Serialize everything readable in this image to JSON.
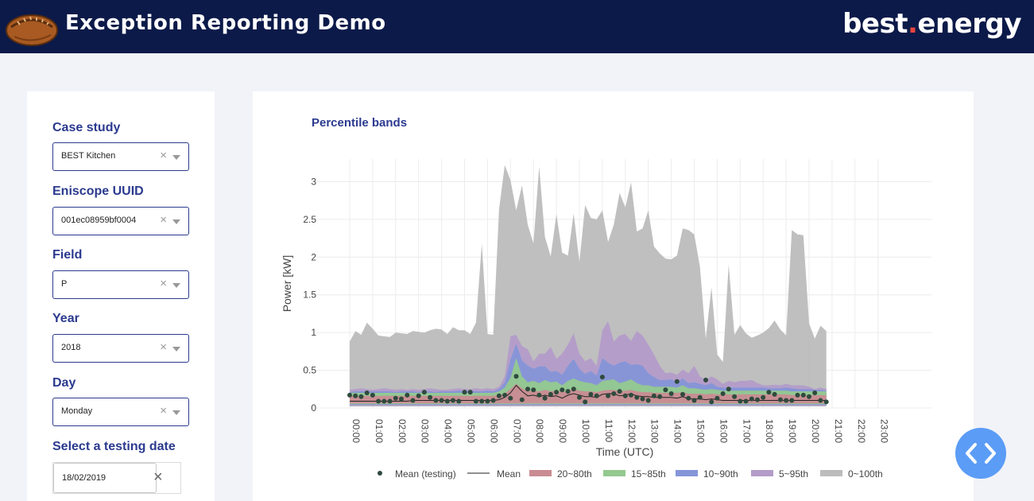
{
  "header": {
    "title": "Exception Reporting Demo",
    "brand_main": "best",
    "brand_dot": ".",
    "brand_rest": "energy"
  },
  "sidebar": {
    "fields": [
      {
        "label": "Case study",
        "value": "BEST Kitchen"
      },
      {
        "label": "Eniscope UUID",
        "value": "001ec08959bf0004"
      },
      {
        "label": "Field",
        "value": "P"
      },
      {
        "label": "Year",
        "value": "2018"
      },
      {
        "label": "Day",
        "value": "Monday"
      }
    ],
    "testing_date": {
      "label": "Select a testing date",
      "value": "18/02/2019"
    }
  },
  "colors": {
    "accent": "#2b3a8f",
    "header_bg": "#0c1a49",
    "brand_dot": "#e8453c",
    "fab": "#5b9cf6"
  },
  "icons": {
    "logo": "pasty-logo-icon",
    "clear": "clear-icon",
    "caret": "chevron-down-icon",
    "fab": "code-icon"
  },
  "chart_data": {
    "type": "area",
    "title": "Percentile bands",
    "xlabel": "Time (UTC)",
    "ylabel": "Power [kW]",
    "ylim": [
      0,
      3.3
    ],
    "yticks": [
      0,
      0.5,
      1,
      1.5,
      2,
      2.5,
      3
    ],
    "xtick_labels": [
      "00:00",
      "01:00",
      "02:00",
      "03:00",
      "04:00",
      "05:00",
      "06:00",
      "07:00",
      "08:00",
      "09:00",
      "10:00",
      "11:00",
      "12:00",
      "13:00",
      "14:00",
      "15:00",
      "16:00",
      "17:00",
      "18:00",
      "19:00",
      "20:00",
      "21:00",
      "22:00",
      "23:00"
    ],
    "grid": true,
    "legend_position": "bottom",
    "legend": [
      "Mean (testing)",
      "Mean",
      "20~80th",
      "15~85th",
      "10~90th",
      "5~95th",
      "0~100th"
    ],
    "band_colors": {
      "0~100th": "#bcbcbc",
      "5~95th": "#b39cc9",
      "10~90th": "#8595d8",
      "15~85th": "#94c98f",
      "20~80th": "#c98c92"
    },
    "band_upper": {
      "0~100th": [
        0.88,
        1.02,
        0.97,
        1.13,
        1.05,
        0.96,
        0.95,
        0.94,
        1.0,
        0.99,
        0.98,
        1.02,
        1.01,
        1.0,
        1.03,
        1.05,
        1.04,
        0.98,
        1.07,
        1.03,
        1.03,
        0.98,
        1.13,
        2.18,
        0.98,
        0.97,
        2.63,
        3.22,
        3.02,
        2.62,
        2.95,
        2.43,
        2.18,
        3.2,
        2.27,
        2.01,
        2.57,
        2.06,
        2.02,
        2.58,
        1.93,
        2.69,
        2.52,
        2.5,
        2.62,
        2.2,
        2.43,
        2.85,
        2.66,
        2.99,
        2.34,
        2.38,
        2.62,
        2.14,
        2.05,
        1.98,
        1.97,
        2.02,
        2.38,
        2.36,
        2.3,
        1.87,
        0.92,
        1.6,
        0.71,
        0.61,
        1.9,
        0.97,
        1.1,
        0.99,
        0.93,
        0.96,
        1.0,
        1.06,
        1.16,
        1.04,
        0.96,
        2.36,
        2.3,
        2.29,
        1.12,
        0.92,
        1.09,
        1.02
      ],
      "5~95th": [
        0.24,
        0.25,
        0.26,
        0.25,
        0.24,
        0.25,
        0.26,
        0.25,
        0.24,
        0.25,
        0.24,
        0.25,
        0.24,
        0.25,
        0.26,
        0.25,
        0.24,
        0.24,
        0.25,
        0.26,
        0.25,
        0.25,
        0.26,
        0.25,
        0.26,
        0.25,
        0.28,
        0.42,
        0.95,
        0.97,
        0.82,
        0.78,
        0.62,
        0.72,
        0.72,
        0.81,
        0.65,
        0.72,
        0.84,
        0.99,
        0.72,
        0.62,
        0.66,
        0.56,
        1.03,
        1.15,
        0.88,
        0.96,
        0.98,
        0.89,
        1.02,
        0.96,
        0.84,
        0.71,
        0.56,
        0.46,
        0.47,
        0.44,
        0.51,
        0.46,
        0.56,
        0.42,
        0.37,
        0.42,
        0.38,
        0.32,
        0.36,
        0.34,
        0.36,
        0.36,
        0.37,
        0.33,
        0.3,
        0.3,
        0.31,
        0.3,
        0.32,
        0.3,
        0.3,
        0.3,
        0.28,
        0.25,
        0.27,
        0.25
      ],
      "10~90th": [
        0.21,
        0.22,
        0.22,
        0.22,
        0.22,
        0.22,
        0.22,
        0.22,
        0.21,
        0.22,
        0.22,
        0.22,
        0.21,
        0.22,
        0.22,
        0.21,
        0.22,
        0.22,
        0.22,
        0.23,
        0.22,
        0.23,
        0.22,
        0.22,
        0.23,
        0.22,
        0.25,
        0.34,
        0.64,
        0.85,
        0.63,
        0.56,
        0.52,
        0.55,
        0.55,
        0.48,
        0.49,
        0.44,
        0.56,
        0.65,
        0.52,
        0.45,
        0.49,
        0.43,
        0.66,
        0.6,
        0.56,
        0.6,
        0.62,
        0.57,
        0.58,
        0.56,
        0.46,
        0.41,
        0.37,
        0.37,
        0.38,
        0.34,
        0.39,
        0.33,
        0.34,
        0.32,
        0.3,
        0.33,
        0.28,
        0.27,
        0.27,
        0.27,
        0.27,
        0.27,
        0.27,
        0.27,
        0.27,
        0.26,
        0.26,
        0.26,
        0.27,
        0.26,
        0.25,
        0.25,
        0.25,
        0.24,
        0.24,
        0.23
      ],
      "15~85th": [
        0.2,
        0.2,
        0.2,
        0.2,
        0.2,
        0.2,
        0.2,
        0.2,
        0.2,
        0.2,
        0.2,
        0.2,
        0.2,
        0.2,
        0.2,
        0.2,
        0.2,
        0.2,
        0.2,
        0.2,
        0.2,
        0.2,
        0.2,
        0.2,
        0.2,
        0.2,
        0.22,
        0.27,
        0.4,
        0.66,
        0.42,
        0.34,
        0.36,
        0.33,
        0.37,
        0.34,
        0.35,
        0.3,
        0.36,
        0.39,
        0.36,
        0.34,
        0.33,
        0.3,
        0.36,
        0.37,
        0.38,
        0.33,
        0.35,
        0.38,
        0.33,
        0.3,
        0.3,
        0.28,
        0.28,
        0.28,
        0.28,
        0.27,
        0.3,
        0.26,
        0.26,
        0.25,
        0.24,
        0.25,
        0.24,
        0.23,
        0.23,
        0.23,
        0.23,
        0.23,
        0.23,
        0.23,
        0.23,
        0.23,
        0.23,
        0.23,
        0.23,
        0.22,
        0.22,
        0.22,
        0.22,
        0.22,
        0.22,
        0.22
      ],
      "20~80th": [
        0.16,
        0.16,
        0.16,
        0.16,
        0.16,
        0.16,
        0.16,
        0.16,
        0.16,
        0.16,
        0.16,
        0.16,
        0.16,
        0.16,
        0.16,
        0.16,
        0.16,
        0.16,
        0.16,
        0.16,
        0.16,
        0.16,
        0.16,
        0.16,
        0.16,
        0.16,
        0.17,
        0.19,
        0.25,
        0.32,
        0.26,
        0.22,
        0.23,
        0.22,
        0.24,
        0.22,
        0.23,
        0.21,
        0.23,
        0.25,
        0.23,
        0.22,
        0.22,
        0.21,
        0.23,
        0.24,
        0.24,
        0.22,
        0.23,
        0.24,
        0.22,
        0.21,
        0.21,
        0.2,
        0.2,
        0.2,
        0.2,
        0.2,
        0.21,
        0.19,
        0.19,
        0.19,
        0.18,
        0.19,
        0.18,
        0.18,
        0.18,
        0.18,
        0.18,
        0.18,
        0.18,
        0.18,
        0.18,
        0.18,
        0.18,
        0.18,
        0.18,
        0.17,
        0.17,
        0.17,
        0.17,
        0.17,
        0.17,
        0.17
      ]
    },
    "band_lower": {
      "0~100th": [
        0.02,
        0.02,
        0.02,
        0.02,
        0.02,
        0.02,
        0.02,
        0.02,
        0.02,
        0.02,
        0.02,
        0.02,
        0.02,
        0.02,
        0.02,
        0.02,
        0.02,
        0.02,
        0.02,
        0.02,
        0.02,
        0.02,
        0.02,
        0.02,
        0.02,
        0.02,
        0.02,
        0.02,
        0.02,
        0.02,
        0.02,
        0.02,
        0.02,
        0.02,
        0.02,
        0.02,
        0.02,
        0.02,
        0.02,
        0.02,
        0.02,
        0.02,
        0.02,
        0.02,
        0.02,
        0.02,
        0.02,
        0.02,
        0.02,
        0.02,
        0.02,
        0.02,
        0.02,
        0.02,
        0.02,
        0.02,
        0.02,
        0.02,
        0.02,
        0.02,
        0.02,
        0.02,
        0.02,
        0.02,
        0.02,
        0.02,
        0.02,
        0.02,
        0.02,
        0.02,
        0.02,
        0.02,
        0.02,
        0.02,
        0.02,
        0.02,
        0.02,
        0.02,
        0.02,
        0.02,
        0.02,
        0.02,
        0.02,
        0.02
      ],
      "5~95th": [
        0.03,
        0.03,
        0.03,
        0.03,
        0.03,
        0.03,
        0.03,
        0.03,
        0.03,
        0.03,
        0.03,
        0.03,
        0.03,
        0.03,
        0.03,
        0.03,
        0.03,
        0.03,
        0.03,
        0.03,
        0.03,
        0.03,
        0.03,
        0.03,
        0.03,
        0.03,
        0.03,
        0.03,
        0.03,
        0.03,
        0.03,
        0.03,
        0.03,
        0.03,
        0.03,
        0.03,
        0.03,
        0.03,
        0.03,
        0.03,
        0.03,
        0.03,
        0.03,
        0.03,
        0.03,
        0.03,
        0.03,
        0.03,
        0.03,
        0.03,
        0.03,
        0.03,
        0.03,
        0.03,
        0.03,
        0.03,
        0.03,
        0.03,
        0.03,
        0.03,
        0.03,
        0.03,
        0.03,
        0.03,
        0.03,
        0.03,
        0.03,
        0.03,
        0.03,
        0.03,
        0.03,
        0.03,
        0.03,
        0.03,
        0.03,
        0.03,
        0.03,
        0.03,
        0.03,
        0.03,
        0.03,
        0.03,
        0.03,
        0.03
      ],
      "10~90th": [
        0.04,
        0.04,
        0.04,
        0.04,
        0.04,
        0.04,
        0.04,
        0.04,
        0.04,
        0.04,
        0.04,
        0.04,
        0.04,
        0.04,
        0.04,
        0.04,
        0.04,
        0.04,
        0.04,
        0.04,
        0.04,
        0.04,
        0.04,
        0.04,
        0.04,
        0.04,
        0.04,
        0.04,
        0.04,
        0.04,
        0.04,
        0.04,
        0.04,
        0.04,
        0.04,
        0.04,
        0.04,
        0.04,
        0.04,
        0.04,
        0.04,
        0.04,
        0.04,
        0.04,
        0.04,
        0.04,
        0.04,
        0.04,
        0.04,
        0.04,
        0.04,
        0.04,
        0.04,
        0.04,
        0.04,
        0.04,
        0.04,
        0.04,
        0.04,
        0.04,
        0.04,
        0.04,
        0.04,
        0.04,
        0.04,
        0.04,
        0.04,
        0.04,
        0.04,
        0.04,
        0.04,
        0.04,
        0.04,
        0.04,
        0.04,
        0.04,
        0.04,
        0.04,
        0.04,
        0.04,
        0.04,
        0.04,
        0.04,
        0.04
      ],
      "15~85th": [
        0.05,
        0.05,
        0.05,
        0.05,
        0.05,
        0.05,
        0.05,
        0.05,
        0.05,
        0.05,
        0.05,
        0.05,
        0.05,
        0.05,
        0.05,
        0.05,
        0.05,
        0.05,
        0.05,
        0.05,
        0.05,
        0.05,
        0.05,
        0.05,
        0.05,
        0.05,
        0.05,
        0.05,
        0.05,
        0.05,
        0.05,
        0.05,
        0.05,
        0.05,
        0.05,
        0.05,
        0.05,
        0.05,
        0.05,
        0.05,
        0.05,
        0.05,
        0.05,
        0.05,
        0.05,
        0.05,
        0.05,
        0.05,
        0.05,
        0.05,
        0.05,
        0.05,
        0.05,
        0.05,
        0.05,
        0.05,
        0.05,
        0.05,
        0.05,
        0.05,
        0.05,
        0.05,
        0.05,
        0.05,
        0.05,
        0.05,
        0.05,
        0.05,
        0.05,
        0.05,
        0.05,
        0.05,
        0.05,
        0.05,
        0.05,
        0.05,
        0.05,
        0.05,
        0.05,
        0.05,
        0.05,
        0.05,
        0.05,
        0.05
      ],
      "20~80th": [
        0.06,
        0.06,
        0.06,
        0.06,
        0.06,
        0.06,
        0.06,
        0.06,
        0.06,
        0.06,
        0.06,
        0.06,
        0.06,
        0.06,
        0.06,
        0.06,
        0.06,
        0.06,
        0.06,
        0.06,
        0.06,
        0.06,
        0.06,
        0.06,
        0.06,
        0.06,
        0.06,
        0.06,
        0.06,
        0.06,
        0.06,
        0.06,
        0.06,
        0.06,
        0.06,
        0.06,
        0.06,
        0.06,
        0.06,
        0.06,
        0.06,
        0.06,
        0.06,
        0.06,
        0.06,
        0.06,
        0.06,
        0.06,
        0.06,
        0.06,
        0.06,
        0.06,
        0.06,
        0.06,
        0.06,
        0.06,
        0.06,
        0.06,
        0.06,
        0.06,
        0.06,
        0.06,
        0.06,
        0.06,
        0.06,
        0.06,
        0.06,
        0.06,
        0.06,
        0.06,
        0.06,
        0.06,
        0.06,
        0.06,
        0.06,
        0.06,
        0.06,
        0.06,
        0.06,
        0.06,
        0.06,
        0.06,
        0.06,
        0.06
      ]
    },
    "mean": [
      0.09,
      0.09,
      0.09,
      0.09,
      0.09,
      0.09,
      0.09,
      0.09,
      0.09,
      0.09,
      0.09,
      0.1,
      0.1,
      0.1,
      0.1,
      0.1,
      0.1,
      0.1,
      0.1,
      0.1,
      0.1,
      0.1,
      0.1,
      0.1,
      0.1,
      0.1,
      0.11,
      0.14,
      0.2,
      0.3,
      0.22,
      0.16,
      0.17,
      0.15,
      0.17,
      0.15,
      0.16,
      0.13,
      0.17,
      0.19,
      0.17,
      0.15,
      0.15,
      0.14,
      0.18,
      0.19,
      0.19,
      0.16,
      0.17,
      0.19,
      0.16,
      0.15,
      0.15,
      0.14,
      0.14,
      0.14,
      0.14,
      0.13,
      0.15,
      0.12,
      0.12,
      0.12,
      0.11,
      0.12,
      0.11,
      0.1,
      0.1,
      0.1,
      0.1,
      0.1,
      0.1,
      0.1,
      0.1,
      0.1,
      0.1,
      0.1,
      0.1,
      0.1,
      0.1,
      0.1,
      0.1,
      0.1,
      0.1,
      0.1
    ],
    "mean_testing": [
      0.17,
      0.16,
      0.15,
      0.2,
      0.17,
      0.09,
      0.09,
      0.09,
      0.13,
      0.12,
      0.17,
      0.1,
      0.16,
      0.21,
      0.14,
      0.1,
      0.1,
      0.09,
      0.1,
      0.09,
      0.21,
      0.21,
      0.09,
      0.09,
      0.09,
      0.1,
      0.16,
      0.17,
      0.13,
      0.42,
      0.11,
      0.25,
      0.24,
      0.17,
      0.13,
      0.18,
      0.21,
      0.24,
      0.22,
      0.25,
      0.14,
      0.08,
      0.18,
      0.16,
      0.41,
      0.16,
      0.19,
      0.22,
      0.16,
      0.17,
      0.14,
      0.12,
      0.1,
      0.16,
      0.15,
      0.24,
      0.19,
      0.35,
      0.18,
      0.13,
      0.1,
      0.14,
      0.37,
      0.08,
      0.13,
      0.19,
      0.25,
      0.15,
      0.09,
      0.09,
      0.12,
      0.11,
      0.14,
      0.21,
      0.18,
      0.11,
      0.1,
      0.1,
      0.17,
      0.17,
      0.15,
      0.2,
      0.1,
      0.08
    ]
  }
}
